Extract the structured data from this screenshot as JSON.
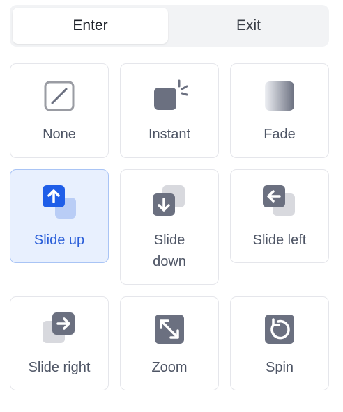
{
  "tabs": {
    "enter": "Enter",
    "exit": "Exit"
  },
  "cards": {
    "none": "None",
    "instant": "Instant",
    "fade": "Fade",
    "slide_up": "Slide up",
    "slide_down_1": "Slide",
    "slide_down_2": "down",
    "slide_left": "Slide left",
    "slide_right": "Slide right",
    "zoom": "Zoom",
    "spin": "Spin"
  },
  "colors": {
    "icon_gray": "#6b7080",
    "icon_light": "#d8d9de",
    "active_blue": "#1f5ee8",
    "active_bg": "#e8f0fe"
  }
}
